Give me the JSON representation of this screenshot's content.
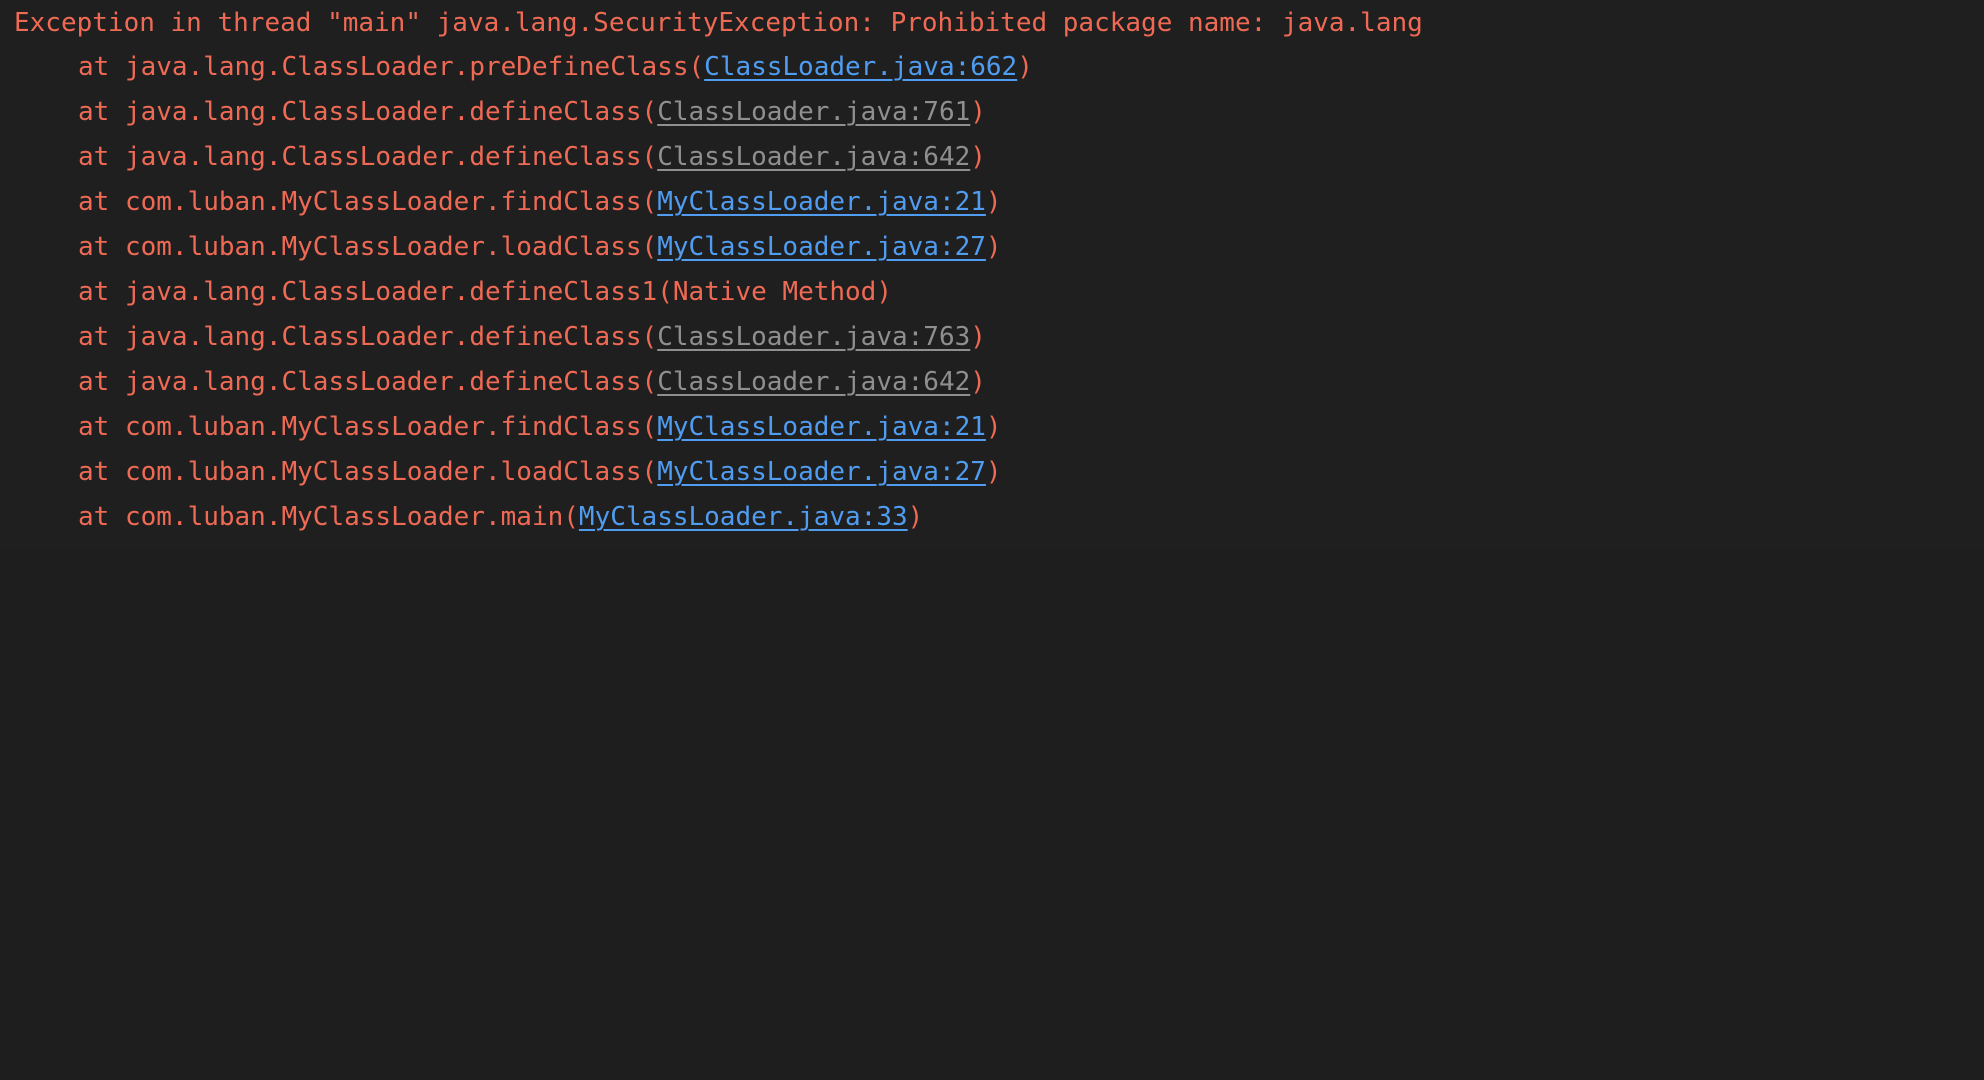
{
  "console": {
    "header": "Exception in thread \"main\" java.lang.SecurityException: Prohibited package name: java.lang",
    "frames": [
      {
        "prefix": "at java.lang.ClassLoader.preDefineClass",
        "source": "ClassLoader.java:662",
        "link_kind": "user"
      },
      {
        "prefix": "at java.lang.ClassLoader.defineClass",
        "source": "ClassLoader.java:761",
        "link_kind": "jdk"
      },
      {
        "prefix": "at java.lang.ClassLoader.defineClass",
        "source": "ClassLoader.java:642",
        "link_kind": "jdk"
      },
      {
        "prefix": "at com.luban.MyClassLoader.findClass",
        "source": "MyClassLoader.java:21",
        "link_kind": "user"
      },
      {
        "prefix": "at com.luban.MyClassLoader.loadClass",
        "source": "MyClassLoader.java:27",
        "link_kind": "user"
      },
      {
        "prefix": "at java.lang.ClassLoader.defineClass1",
        "source": "Native Method",
        "link_kind": "native"
      },
      {
        "prefix": "at java.lang.ClassLoader.defineClass",
        "source": "ClassLoader.java:763",
        "link_kind": "jdk"
      },
      {
        "prefix": "at java.lang.ClassLoader.defineClass",
        "source": "ClassLoader.java:642",
        "link_kind": "jdk"
      },
      {
        "prefix": "at com.luban.MyClassLoader.findClass",
        "source": "MyClassLoader.java:21",
        "link_kind": "user"
      },
      {
        "prefix": "at com.luban.MyClassLoader.loadClass",
        "source": "MyClassLoader.java:27",
        "link_kind": "user"
      },
      {
        "prefix": "at com.luban.MyClassLoader.main",
        "source": "MyClassLoader.java:33",
        "link_kind": "user"
      }
    ],
    "colors": {
      "background": "#1f1f1f",
      "error_text": "#ef6a55",
      "user_link": "#4f9cf0",
      "jdk_link": "#8f8f8f"
    }
  }
}
